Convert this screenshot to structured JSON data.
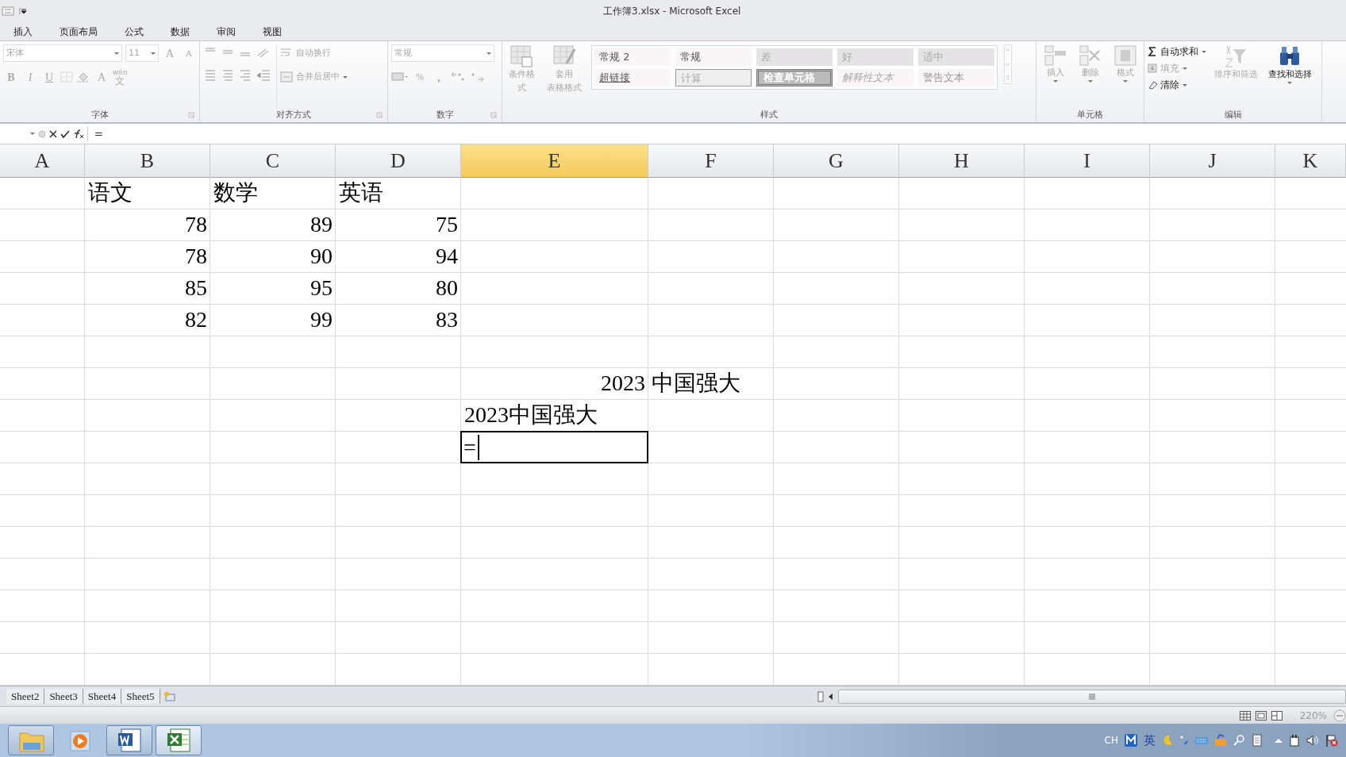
{
  "window": {
    "title": "工作簿3.xlsx  -  Microsoft Excel"
  },
  "ribbon_tabs": [
    {
      "label": "插入"
    },
    {
      "label": "页面布局"
    },
    {
      "label": "公式"
    },
    {
      "label": "数据"
    },
    {
      "label": "审阅"
    },
    {
      "label": "视图"
    }
  ],
  "ribbon": {
    "font": {
      "label": "字体",
      "disabled": true,
      "font_name": "宋体",
      "font_size": "11",
      "grow": "A",
      "shrink": "A",
      "bold": "B",
      "italic": "I",
      "underline": "U",
      "font_color": "A",
      "phonetic_top": "wén",
      "phonetic_bottom": "文"
    },
    "alignment": {
      "label": "对齐方式",
      "disabled": true,
      "wrap_text": "自动换行",
      "merge": "合并后居中"
    },
    "number": {
      "label": "数字",
      "disabled": true,
      "format": "常规",
      "percent": "%",
      "comma": ","
    },
    "styles": {
      "label": "样式",
      "disabled": true,
      "conditional": "条件格式",
      "table_top": "套用",
      "table_bottom": "表格格式",
      "gallery": [
        {
          "label": "常规 2",
          "kind": "normal"
        },
        {
          "label": "常规",
          "kind": "normal"
        },
        {
          "label": "差",
          "kind": "bad"
        },
        {
          "label": "好",
          "kind": "good"
        },
        {
          "label": "适中",
          "kind": "neutral"
        },
        {
          "label": "超链接",
          "kind": "hyperlink"
        },
        {
          "label": "计算",
          "kind": "calculation"
        },
        {
          "label": "检查单元格",
          "kind": "check"
        },
        {
          "label": "解释性文本",
          "kind": "explanatory"
        },
        {
          "label": "警告文本",
          "kind": "warning"
        }
      ]
    },
    "cells": {
      "label": "单元格",
      "disabled": true,
      "buttons": [
        {
          "label": "插入",
          "kind": "insert"
        },
        {
          "label": "删除",
          "kind": "delete"
        },
        {
          "label": "格式",
          "kind": "format"
        }
      ]
    },
    "editing": {
      "label": "编辑",
      "items": [
        {
          "label": "自动求和",
          "kind": "sum",
          "disabled": false
        },
        {
          "label": "填充",
          "kind": "fill",
          "disabled": true
        },
        {
          "label": "清除",
          "kind": "clear",
          "disabled": false
        }
      ],
      "sort": {
        "label": "排序和筛选",
        "disabled": true
      },
      "find": {
        "label": "查找和选择",
        "disabled": false
      }
    }
  },
  "formula_bar": {
    "content": "="
  },
  "columns": [
    {
      "label": "A",
      "selected": false
    },
    {
      "label": "B",
      "selected": false
    },
    {
      "label": "C",
      "selected": false
    },
    {
      "label": "D",
      "selected": false
    },
    {
      "label": "E",
      "selected": true
    },
    {
      "label": "F",
      "selected": false
    },
    {
      "label": "G",
      "selected": false
    },
    {
      "label": "H",
      "selected": false
    },
    {
      "label": "I",
      "selected": false
    },
    {
      "label": "J",
      "selected": false
    },
    {
      "label": "K",
      "selected": false
    }
  ],
  "rows": [
    {
      "cells": [
        null,
        {
          "text": "语文",
          "kind": "text"
        },
        {
          "text": "数学",
          "kind": "text"
        },
        {
          "text": "英语",
          "kind": "text"
        }
      ]
    },
    {
      "cells": [
        null,
        {
          "text": "78",
          "kind": "number"
        },
        {
          "text": "89",
          "kind": "number"
        },
        {
          "text": "75",
          "kind": "number"
        }
      ]
    },
    {
      "cells": [
        null,
        {
          "text": "78",
          "kind": "number"
        },
        {
          "text": "90",
          "kind": "number"
        },
        {
          "text": "94",
          "kind": "number"
        }
      ]
    },
    {
      "cells": [
        null,
        {
          "text": "85",
          "kind": "number"
        },
        {
          "text": "95",
          "kind": "number"
        },
        {
          "text": "80",
          "kind": "number"
        }
      ]
    },
    {
      "cells": [
        null,
        {
          "text": "82",
          "kind": "number"
        },
        {
          "text": "99",
          "kind": "number"
        },
        {
          "text": "83",
          "kind": "number"
        }
      ]
    },
    {},
    {
      "cells": [
        null,
        null,
        null,
        null,
        {
          "text": "2023",
          "kind": "number"
        },
        {
          "text": "中国强大",
          "kind": "text"
        }
      ]
    },
    {
      "cells": [
        null,
        null,
        null,
        null,
        {
          "text": "2023中国强大",
          "kind": "text"
        }
      ]
    },
    {
      "cells": [
        null,
        null,
        null,
        null,
        {
          "text": "=",
          "kind": "text",
          "editing": true
        }
      ]
    }
  ],
  "sheet_tabs": [
    {
      "label": "Sheet2",
      "selected": false
    },
    {
      "label": "Sheet3",
      "selected": false
    },
    {
      "label": "Sheet4",
      "selected": false
    },
    {
      "label": "Sheet5",
      "selected": false
    }
  ],
  "status_bar": {
    "zoom": "220%"
  },
  "taskbar": {
    "apps": [
      {
        "kind": "folder",
        "open": true,
        "selected": false
      },
      {
        "kind": "media",
        "open": false,
        "selected": false
      },
      {
        "kind": "word",
        "open": true,
        "selected": false
      },
      {
        "kind": "excel",
        "open": true,
        "selected": true
      }
    ],
    "tray": {
      "language": "CH",
      "ime": "英"
    }
  }
}
